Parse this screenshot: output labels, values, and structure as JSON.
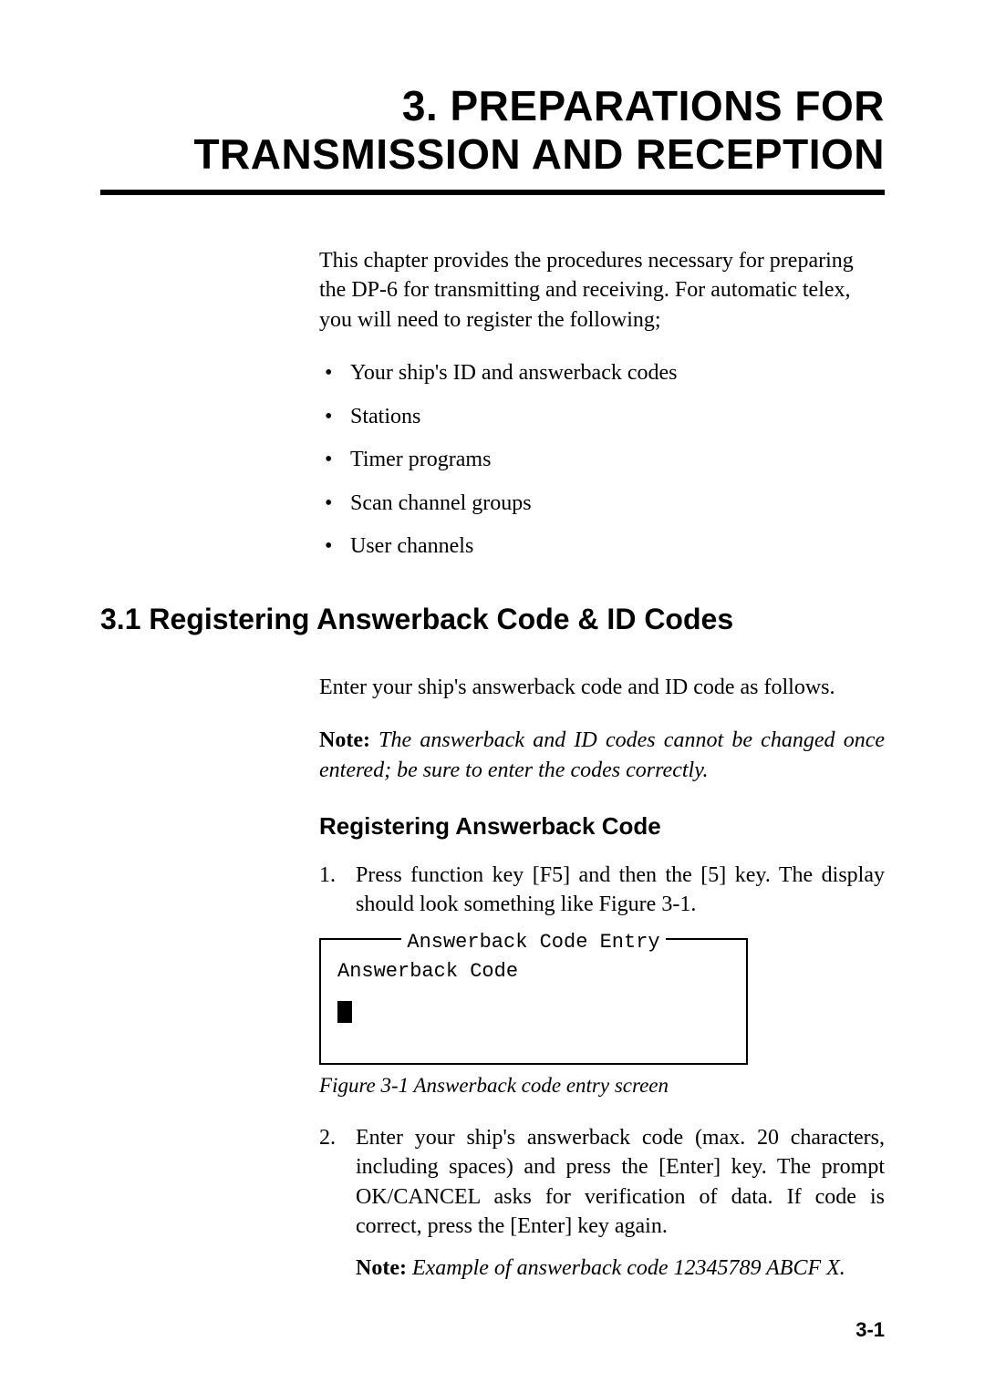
{
  "chapter": {
    "title_line1": "3. PREPARATIONS FOR",
    "title_line2": "TRANSMISSION AND RECEPTION"
  },
  "intro": "This chapter provides the procedures necessary for preparing the DP-6 for transmitting and receiving. For automatic telex, you will need to register the following;",
  "bullets": [
    "Your ship's ID and answerback codes",
    "Stations",
    "Timer programs",
    "Scan channel groups",
    "User channels"
  ],
  "section31": {
    "heading": "3.1 Registering Answerback Code & ID Codes",
    "para1": "Enter your ship's answerback code and ID code as follows.",
    "note1_label": "Note:",
    "note1_body": " The answerback and ID codes cannot be changed once entered; be sure to enter the codes correctly.",
    "sub_heading": "Registering Answerback Code",
    "step1": "Press function key [F5] and then the [5] key. The display should look something like Figure 3-1.",
    "codebox": {
      "legend": "Answerback Code Entry",
      "label": "Answerback Code"
    },
    "fig_caption": "Figure 3-1 Answerback code entry screen",
    "step2": "Enter your ship's answerback code (max. 20 characters, including spaces) and press the [Enter] key. The prompt OK/CANCEL asks for verification of data. If code is correct, press the [Enter] key again.",
    "note2_label": "Note:",
    "note2_body": " Example of answerback code 12345789 ABCF X."
  },
  "page_number": "3-1"
}
